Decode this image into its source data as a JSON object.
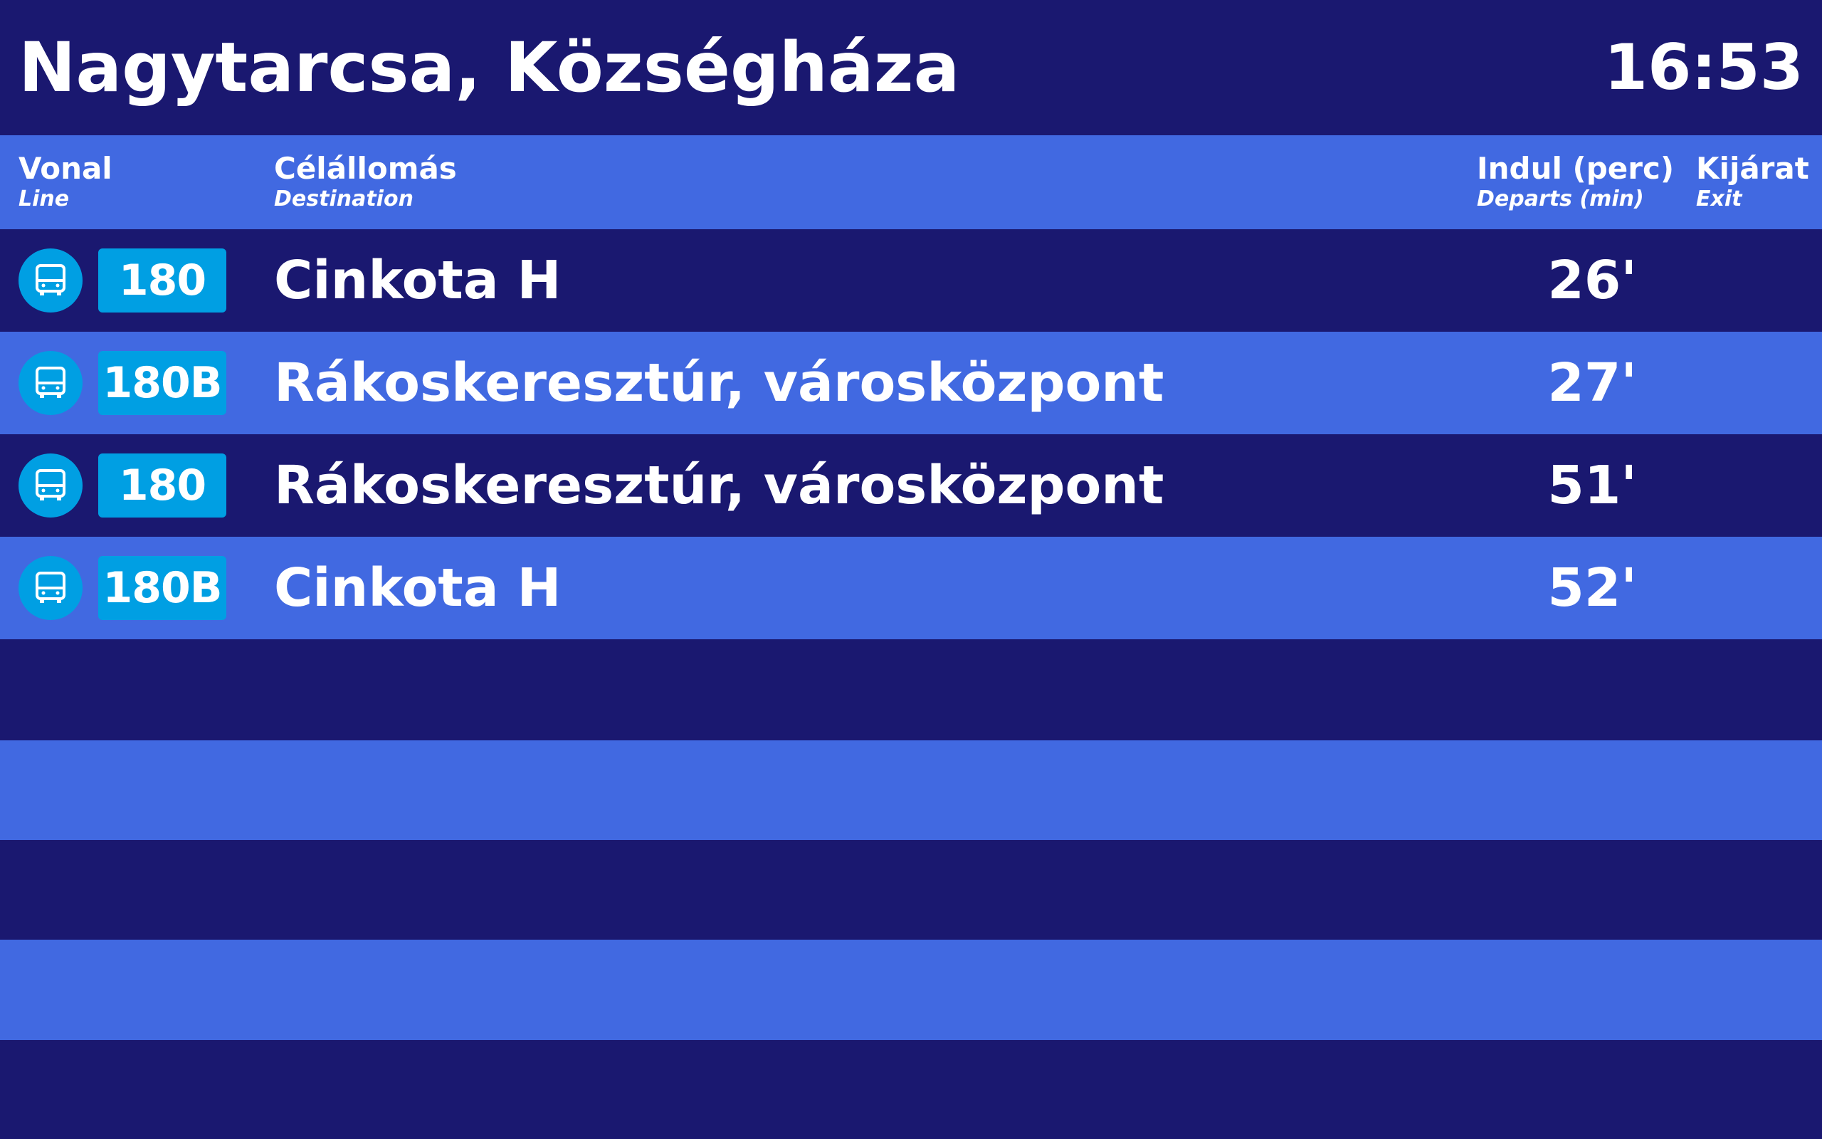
{
  "header": {
    "stop_name": "Nagytarcsa, Községháza",
    "clock": "16:53"
  },
  "columns": {
    "line_hu": "Vonal",
    "line_en": "Line",
    "dest_hu": "Célállomás",
    "dest_en": "Destination",
    "dep_hu": "Indul (perc)",
    "dep_en": "Departs (min)",
    "exit_hu": "Kijárat",
    "exit_en": "Exit"
  },
  "departures": [
    {
      "icon": "bus-icon",
      "line": "180",
      "destination": "Cinkota H",
      "minutes": "26'",
      "exit": ""
    },
    {
      "icon": "bus-icon",
      "line": "180B",
      "destination": "Rákoskeresztúr, városközpont",
      "minutes": "27'",
      "exit": ""
    },
    {
      "icon": "bus-icon",
      "line": "180",
      "destination": "Rákoskeresztúr, városközpont",
      "minutes": "51'",
      "exit": ""
    },
    {
      "icon": "bus-icon",
      "line": "180B",
      "destination": "Cinkota H",
      "minutes": "52'",
      "exit": ""
    }
  ],
  "colors": {
    "dark_row": "#1a1870",
    "light_row": "#4169e1",
    "line_badge": "#009fe3",
    "text": "#ffffff"
  }
}
